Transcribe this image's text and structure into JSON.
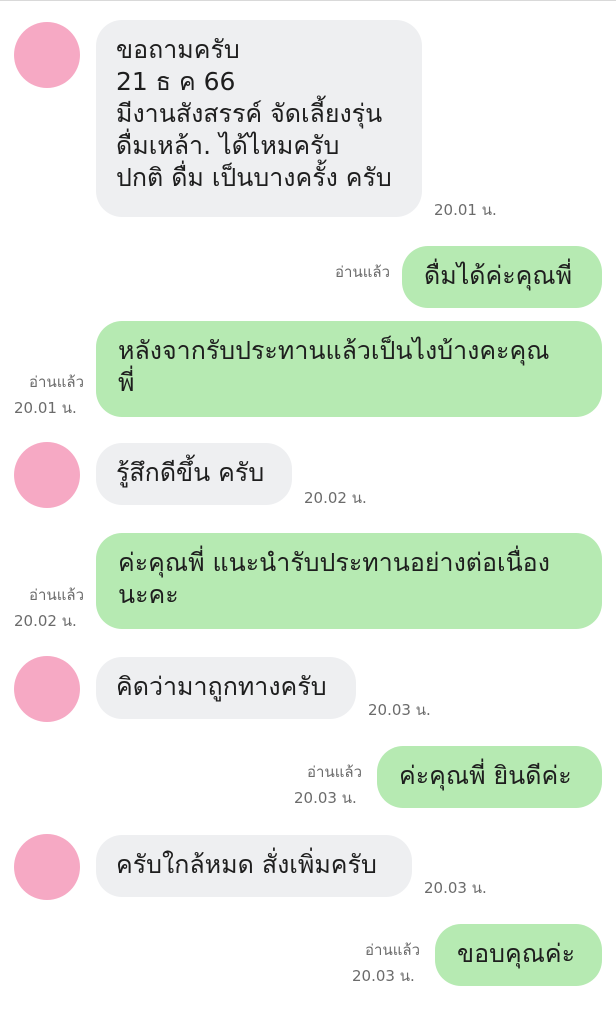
{
  "messages": [
    {
      "lines": [
        "ขอถามครับ",
        "21 ธ ค 66",
        "มีงานสังสรรค์ จัดเลี้ยงรุ่น",
        "ดื่มเหล้า.  ได้ไหมครับ",
        "ปกติ ดื่ม เป็นบางครั้ง ครับ"
      ],
      "time": "20.01 น."
    },
    {
      "lines": [
        "ดื่มได้ค่ะคุณพี่"
      ],
      "read": "อ่านแล้ว"
    },
    {
      "lines": [
        "หลังจากรับประทานแล้วเป็นไงบ้างคะคุณ",
        "พี่"
      ],
      "read": "อ่านแล้ว",
      "time": "20.01 น."
    },
    {
      "lines": [
        "รู้สึกดีขึ้น ครับ"
      ],
      "time": "20.02 น."
    },
    {
      "lines": [
        "ค่ะคุณพี่ แนะนำรับประทานอย่างต่อเนื่อง",
        "นะคะ"
      ],
      "read": "อ่านแล้ว",
      "time": "20.02 น."
    },
    {
      "lines": [
        "คิดว่ามาถูกทางครับ"
      ],
      "time": "20.03 น."
    },
    {
      "lines": [
        "ค่ะคุณพี่ ยินดีค่ะ"
      ],
      "read": "อ่านแล้ว",
      "time": "20.03 น."
    },
    {
      "lines": [
        "ครับใกล้หมด สั่งเพิ่มครับ"
      ],
      "time": "20.03 น."
    },
    {
      "lines": [
        "ขอบคุณค่ะ"
      ],
      "read": "อ่านแล้ว",
      "time": "20.03 น."
    }
  ],
  "colors": {
    "incoming_bubble": "#eeeff1",
    "outgoing_bubble": "#b6eab2",
    "avatar": "#f6a9c4"
  }
}
